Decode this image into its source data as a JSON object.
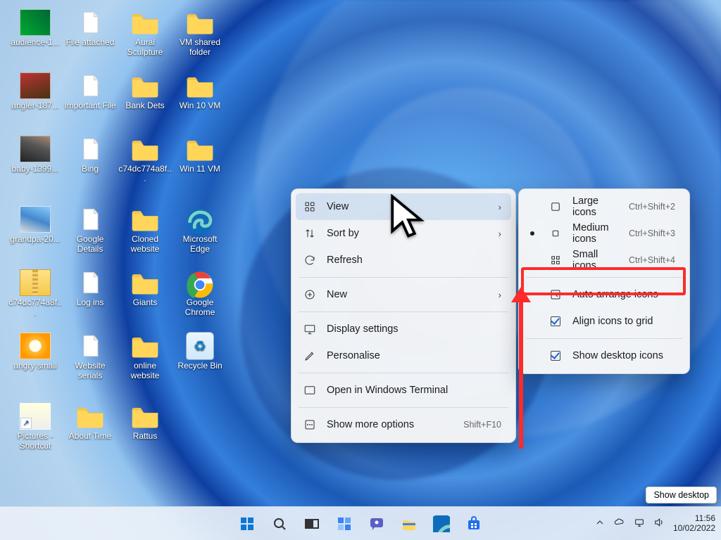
{
  "desktop_icons": [
    {
      "col": 0,
      "row": 0,
      "type": "thumb",
      "variant": "a",
      "label": "audience-1..."
    },
    {
      "col": 0,
      "row": 1,
      "type": "thumb",
      "variant": "b",
      "label": "angler-187..."
    },
    {
      "col": 0,
      "row": 2,
      "type": "thumb",
      "variant": "c",
      "label": "baby-1399..."
    },
    {
      "col": 0,
      "row": 3,
      "type": "thumb",
      "variant": "d",
      "label": "grandpa-20..."
    },
    {
      "col": 0,
      "row": 4,
      "type": "zip",
      "label": "c74dc774a8f..."
    },
    {
      "col": 0,
      "row": 5,
      "type": "thumb",
      "variant": "e",
      "label": "angry small"
    },
    {
      "col": 0,
      "row": 6,
      "type": "thumb",
      "variant": "f",
      "label": "Pictures - Shortcut"
    },
    {
      "col": 1,
      "row": 0,
      "type": "file",
      "label": "File attached"
    },
    {
      "col": 1,
      "row": 1,
      "type": "file",
      "label": "Important File"
    },
    {
      "col": 1,
      "row": 2,
      "type": "file",
      "label": "Bing"
    },
    {
      "col": 1,
      "row": 3,
      "type": "file",
      "label": "Google Details"
    },
    {
      "col": 1,
      "row": 4,
      "type": "file",
      "label": "Log ins"
    },
    {
      "col": 1,
      "row": 5,
      "type": "file",
      "label": "Website serials"
    },
    {
      "col": 1,
      "row": 6,
      "type": "folder",
      "label": "About Time"
    },
    {
      "col": 2,
      "row": 0,
      "type": "folder",
      "label": "Aural Sculpture"
    },
    {
      "col": 2,
      "row": 1,
      "type": "folder",
      "label": "Bank Dets"
    },
    {
      "col": 2,
      "row": 2,
      "type": "folder",
      "label": "c74dc774a8f..."
    },
    {
      "col": 2,
      "row": 3,
      "type": "folder",
      "label": "Cloned website"
    },
    {
      "col": 2,
      "row": 4,
      "type": "folder",
      "label": "Giants"
    },
    {
      "col": 2,
      "row": 5,
      "type": "folder",
      "label": "online website"
    },
    {
      "col": 2,
      "row": 6,
      "type": "folder",
      "label": "Rattus"
    },
    {
      "col": 3,
      "row": 0,
      "type": "folder",
      "label": "VM shared folder"
    },
    {
      "col": 3,
      "row": 1,
      "type": "folder",
      "label": "Win 10 VM"
    },
    {
      "col": 3,
      "row": 2,
      "type": "folder",
      "label": "Win 11 VM"
    },
    {
      "col": 3,
      "row": 3,
      "type": "edge",
      "label": "Microsoft Edge"
    },
    {
      "col": 3,
      "row": 4,
      "type": "chrome",
      "label": "Google Chrome"
    },
    {
      "col": 3,
      "row": 5,
      "type": "recycle",
      "label": "Recycle Bin"
    }
  ],
  "context_menu": {
    "items": [
      {
        "icon": "grid",
        "label": "View",
        "submenu": true,
        "highlight": true
      },
      {
        "icon": "sort",
        "label": "Sort by",
        "submenu": true
      },
      {
        "icon": "refresh",
        "label": "Refresh"
      },
      {
        "sep": true
      },
      {
        "icon": "plus",
        "label": "New",
        "submenu": true
      },
      {
        "sep": true
      },
      {
        "icon": "display",
        "label": "Display settings"
      },
      {
        "icon": "pen",
        "label": "Personalise"
      },
      {
        "sep": true
      },
      {
        "icon": "terminal",
        "label": "Open in Windows Terminal"
      },
      {
        "sep": true
      },
      {
        "icon": "more",
        "label": "Show more options",
        "accel": "Shift+F10"
      }
    ]
  },
  "view_submenu": {
    "items": [
      {
        "icon": "lg",
        "label": "Large icons",
        "accel": "Ctrl+Shift+2"
      },
      {
        "icon": "md",
        "label": "Medium icons",
        "accel": "Ctrl+Shift+3",
        "selected": true
      },
      {
        "icon": "sm",
        "label": "Small icons",
        "accel": "Ctrl+Shift+4"
      },
      {
        "sep": true
      },
      {
        "icon": "auto",
        "label": "Auto arrange icons",
        "annot": true
      },
      {
        "icon": "align",
        "label": "Align icons to grid",
        "checked": true
      },
      {
        "sep": true
      },
      {
        "icon": "show",
        "label": "Show desktop icons",
        "checked": true
      }
    ]
  },
  "taskbar": {
    "apps": [
      "start",
      "search",
      "taskview",
      "widgets",
      "chat",
      "explorer",
      "edge",
      "store"
    ]
  },
  "tray": {
    "time": "11:56",
    "date": "10/02/2022",
    "show_desktop_tooltip": "Show desktop"
  }
}
